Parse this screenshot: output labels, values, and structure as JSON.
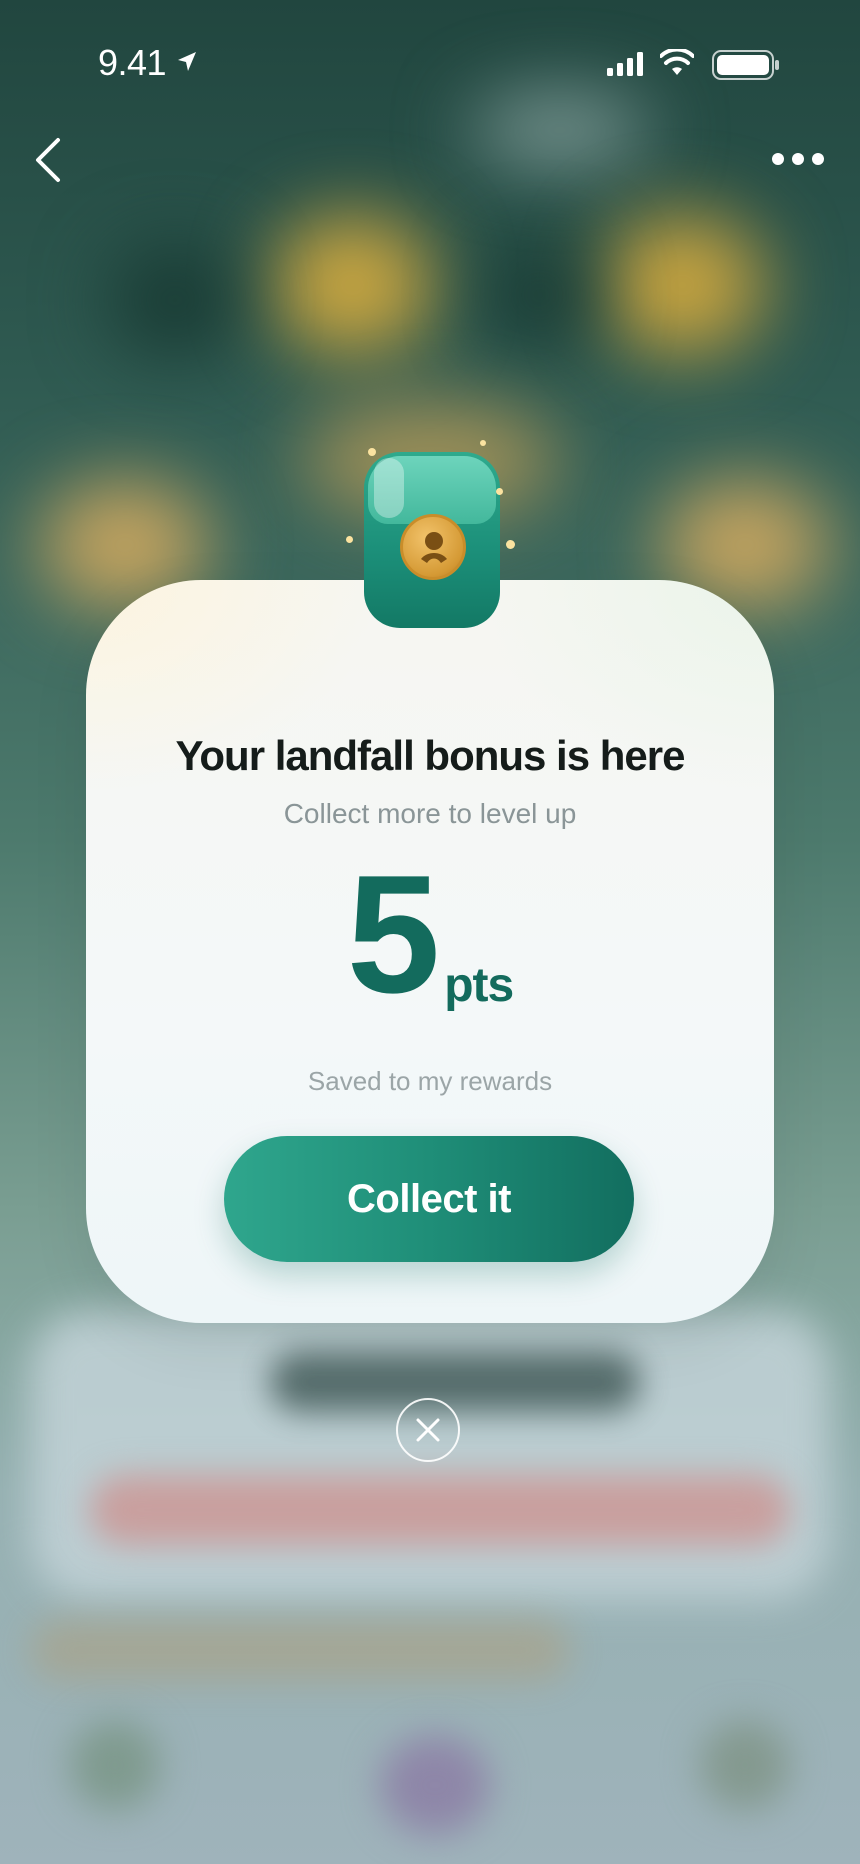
{
  "status_bar": {
    "time": "9.41",
    "icons": [
      "location-arrow-icon",
      "cellular-signal-icon",
      "wifi-icon",
      "battery-icon"
    ]
  },
  "nav": {
    "back_icon": "chevron-left-icon",
    "more_icon": "more-dots-icon"
  },
  "reward_modal": {
    "badge_icon": "wallet-coin-icon",
    "title": "Your landfall bonus is here",
    "subtitle": "Collect more to level up",
    "points_value": "5",
    "points_unit": "pts",
    "saved_note": "Saved to my rewards",
    "cta_label": "Collect it",
    "close_icon": "close-icon"
  },
  "colors": {
    "accent": "#136b5d",
    "button_start": "#2fa68d",
    "button_end": "#126e5f",
    "title": "#151c1a",
    "muted": "#8a9597"
  }
}
